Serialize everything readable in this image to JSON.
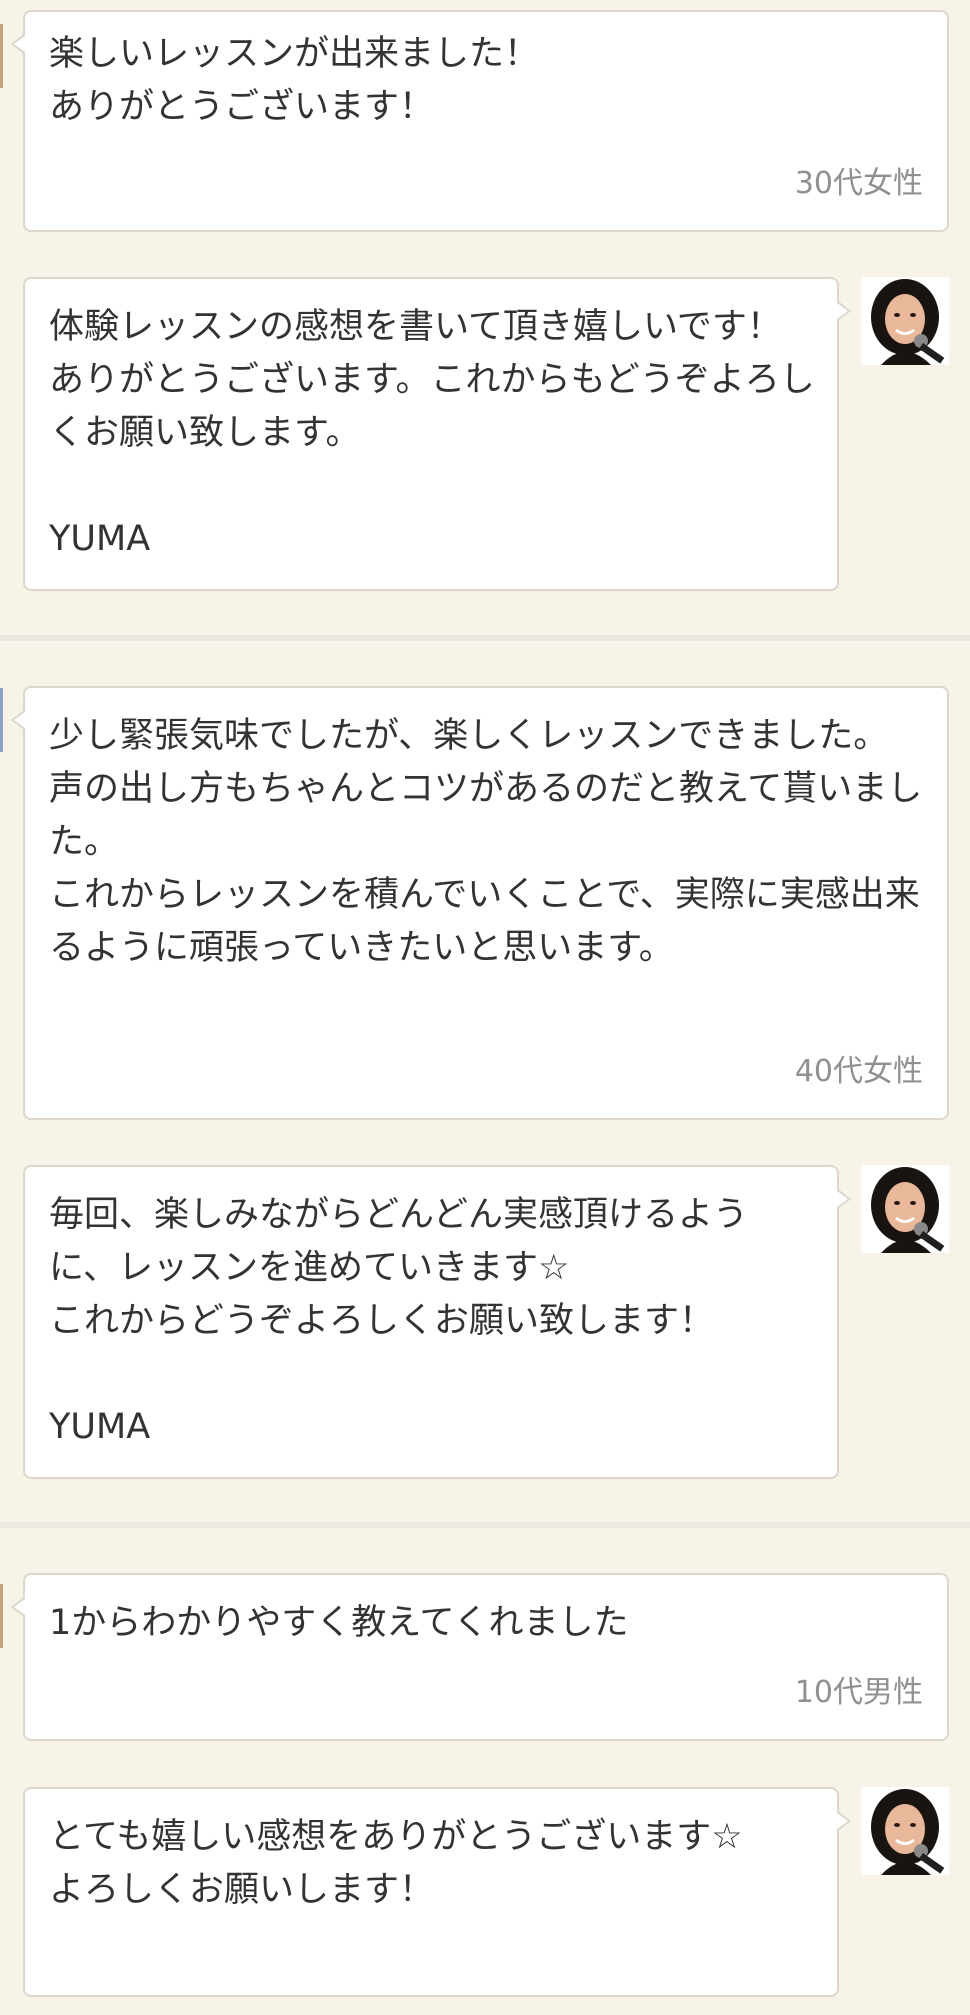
{
  "reviews": [
    {
      "customer_text": "楽しいレッスンが出来ました！\nありがとうございます！",
      "customer_meta": "30代女性",
      "reply_text": "体験レッスンの感想を書いて頂き嬉しいです！ありがとうございます。これからもどうぞよろしくお願い致します。\n\nYUMA"
    },
    {
      "customer_text": "少し緊張気味でしたが、楽しくレッスンできました。\n声の出し方もちゃんとコツがあるのだと教えて貰いました。\nこれからレッスンを積んでいくことで、実際に実感出来るように頑張っていきたいと思います。",
      "customer_meta": "40代女性",
      "reply_text": "毎回、楽しみながらどんどん実感頂けるように、レッスンを進めていきます☆\nこれからどうぞよろしくお願い致します！\n\nYUMA"
    },
    {
      "customer_text": "1からわかりやすく教えてくれました",
      "customer_meta": "10代男性",
      "reply_text": "とても嬉しい感想をありがとうございます☆\nよろしくお願いします！"
    }
  ],
  "avatar_icon": "teacher-avatar-with-microphone",
  "colors": {
    "background": "#f7f3e8",
    "bubble": "#ffffff",
    "bubble_border": "#ddd7cb",
    "meta_text": "#909090",
    "body_text": "#333333",
    "divider": "#ece8df"
  }
}
